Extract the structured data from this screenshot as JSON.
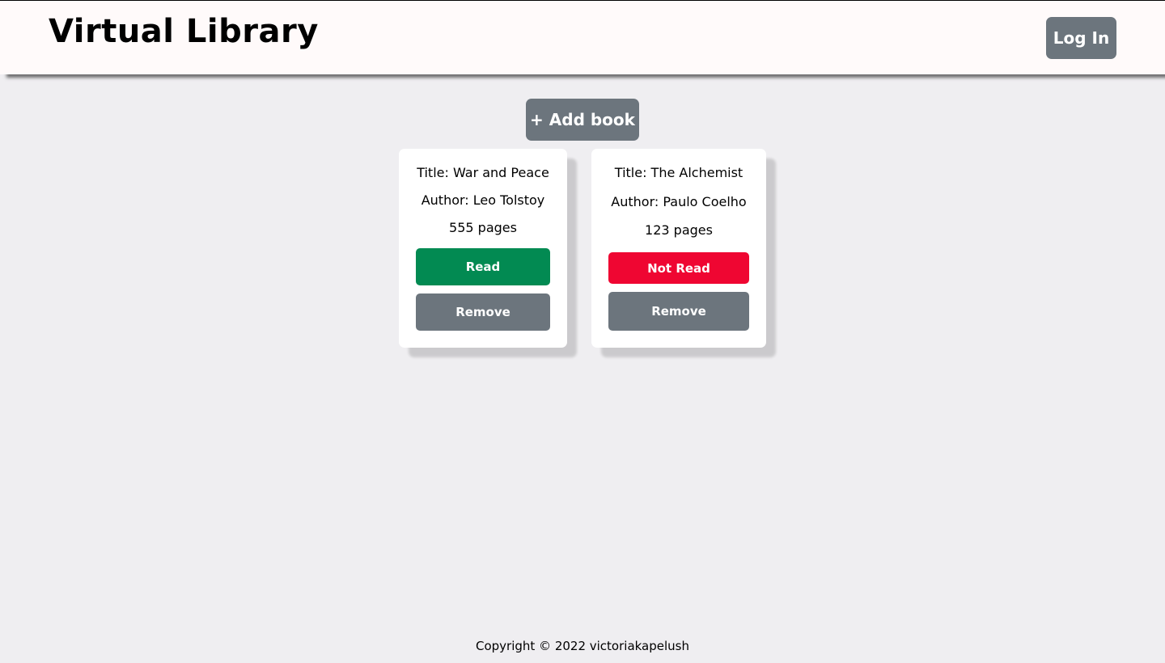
{
  "header": {
    "title": "Virtual Library",
    "login_label": "Log In"
  },
  "main": {
    "add_book_label": "+ Add book",
    "books": [
      {
        "title": "Title: War and Peace",
        "author": "Author: Leo Tolstoy",
        "pages": "555 pages",
        "status_label": "Read",
        "status_color": "#028a52",
        "remove_label": "Remove"
      },
      {
        "title": "Title: The Alchemist",
        "author": "Author: Paulo Coelho",
        "pages": "123 pages",
        "status_label": "Not Read",
        "status_color": "#ef0632",
        "remove_label": "Remove"
      }
    ]
  },
  "footer": {
    "copyright": "Copyright © 2022 victoriakapelush"
  },
  "colors": {
    "background": "#efeef1",
    "header_bg": "#fffafa",
    "button_gray": "#6c757d",
    "read_green": "#028a52",
    "not_read_red": "#ef0632"
  }
}
